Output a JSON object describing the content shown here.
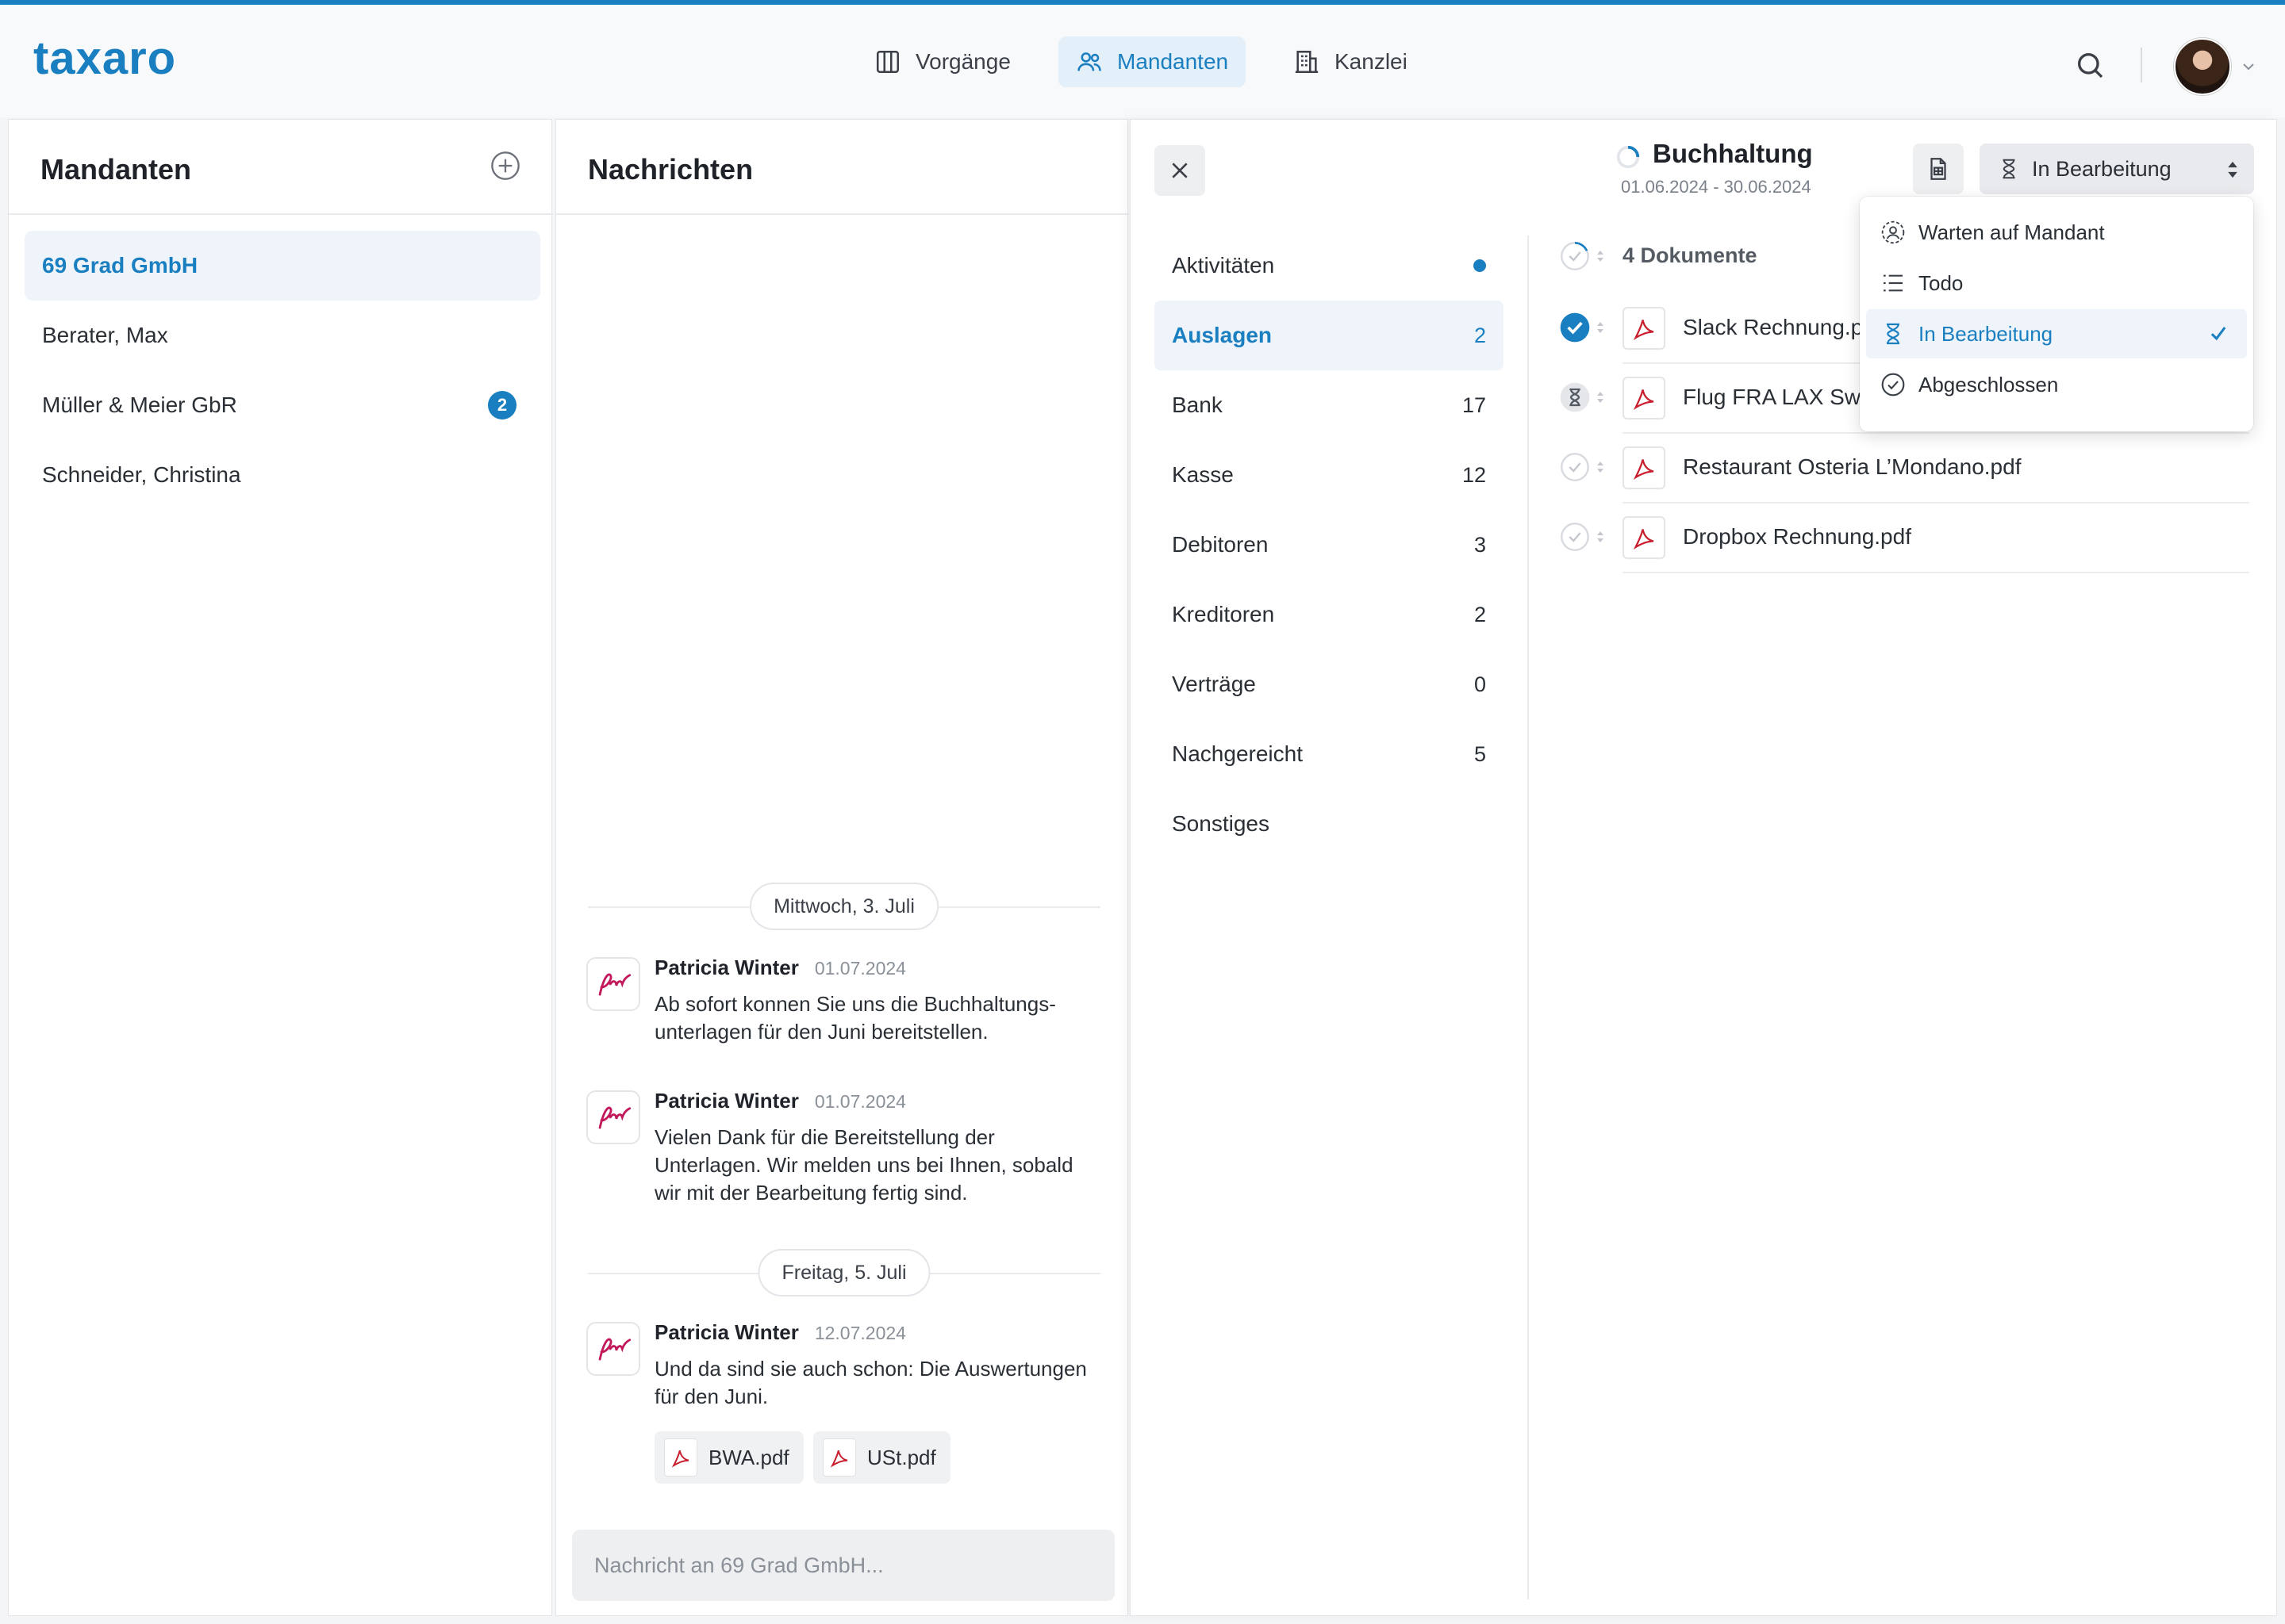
{
  "app": {
    "logo": "taxaro"
  },
  "nav": {
    "tabs": [
      {
        "label": "Vorgänge",
        "icon": "columns-icon"
      },
      {
        "label": "Mandanten",
        "icon": "users-icon",
        "active": true
      },
      {
        "label": "Kanzlei",
        "icon": "building-icon"
      }
    ]
  },
  "clients": {
    "title": "Mandanten",
    "items": [
      {
        "name": "69 Grad GmbH",
        "active": true
      },
      {
        "name": "Berater, Max"
      },
      {
        "name": "Müller & Meier GbR",
        "badge": "2"
      },
      {
        "name": "Schneider, Christina"
      }
    ]
  },
  "messages": {
    "title": "Nachrichten",
    "days": [
      "Mittwoch, 3. Juli",
      "Freitag, 5. Juli"
    ],
    "items": [
      {
        "author": "Patricia Winter",
        "date": "01.07.2024",
        "text": "Ab sofort konnen Sie uns die Buchhaltungs-unterlagen für den Juni bereitstellen."
      },
      {
        "author": "Patricia Winter",
        "date": "01.07.2024",
        "text": "Vielen Dank für die Bereitstellung der Unterlagen. Wir melden uns bei Ihnen, sobald wir mit der Bearbeitung fertig sind."
      },
      {
        "author": "Patricia Winter",
        "date": "12.07.2024",
        "text": "Und da sind sie auch schon: Die Auswertungen für den Juni."
      }
    ],
    "attachments": [
      "BWA.pdf",
      "USt.pdf"
    ],
    "composer_placeholder": "Nachricht an 69 Grad GmbH..."
  },
  "detail": {
    "title": "Buchhaltung",
    "range": "01.06.2024 - 30.06.2024",
    "status": "In Bearbeitung",
    "categories": [
      {
        "label": "Aktivitäten",
        "dot": true
      },
      {
        "label": "Auslagen",
        "count": "2",
        "active": true
      },
      {
        "label": "Bank",
        "count": "17"
      },
      {
        "label": "Kasse",
        "count": "12"
      },
      {
        "label": "Debitoren",
        "count": "3"
      },
      {
        "label": "Kreditoren",
        "count": "2"
      },
      {
        "label": "Verträge",
        "count": "0"
      },
      {
        "label": "Nachgereicht",
        "count": "5"
      },
      {
        "label": "Sonstiges"
      }
    ],
    "doc_count": "4 Dokumente",
    "documents": [
      {
        "name": "Slack Rechnung.pdf",
        "state": "done"
      },
      {
        "name": "Flug FRA LAX Swiss.pdf",
        "state": "pending"
      },
      {
        "name": "Restaurant Osteria L’Mondano.pdf",
        "state": "open"
      },
      {
        "name": "Dropbox Rechnung.pdf",
        "state": "open"
      }
    ]
  },
  "status_dropdown": {
    "options": [
      {
        "label": "Warten auf Mandant",
        "icon": "user-clock-icon"
      },
      {
        "label": "Todo",
        "icon": "list-icon"
      },
      {
        "label": "In Bearbeitung",
        "icon": "hourglass-icon",
        "selected": true
      },
      {
        "label": "Abgeschlossen",
        "icon": "check-circle-icon"
      }
    ]
  },
  "colors": {
    "accent": "#1a7fc1",
    "pdf": "#c8202f"
  }
}
